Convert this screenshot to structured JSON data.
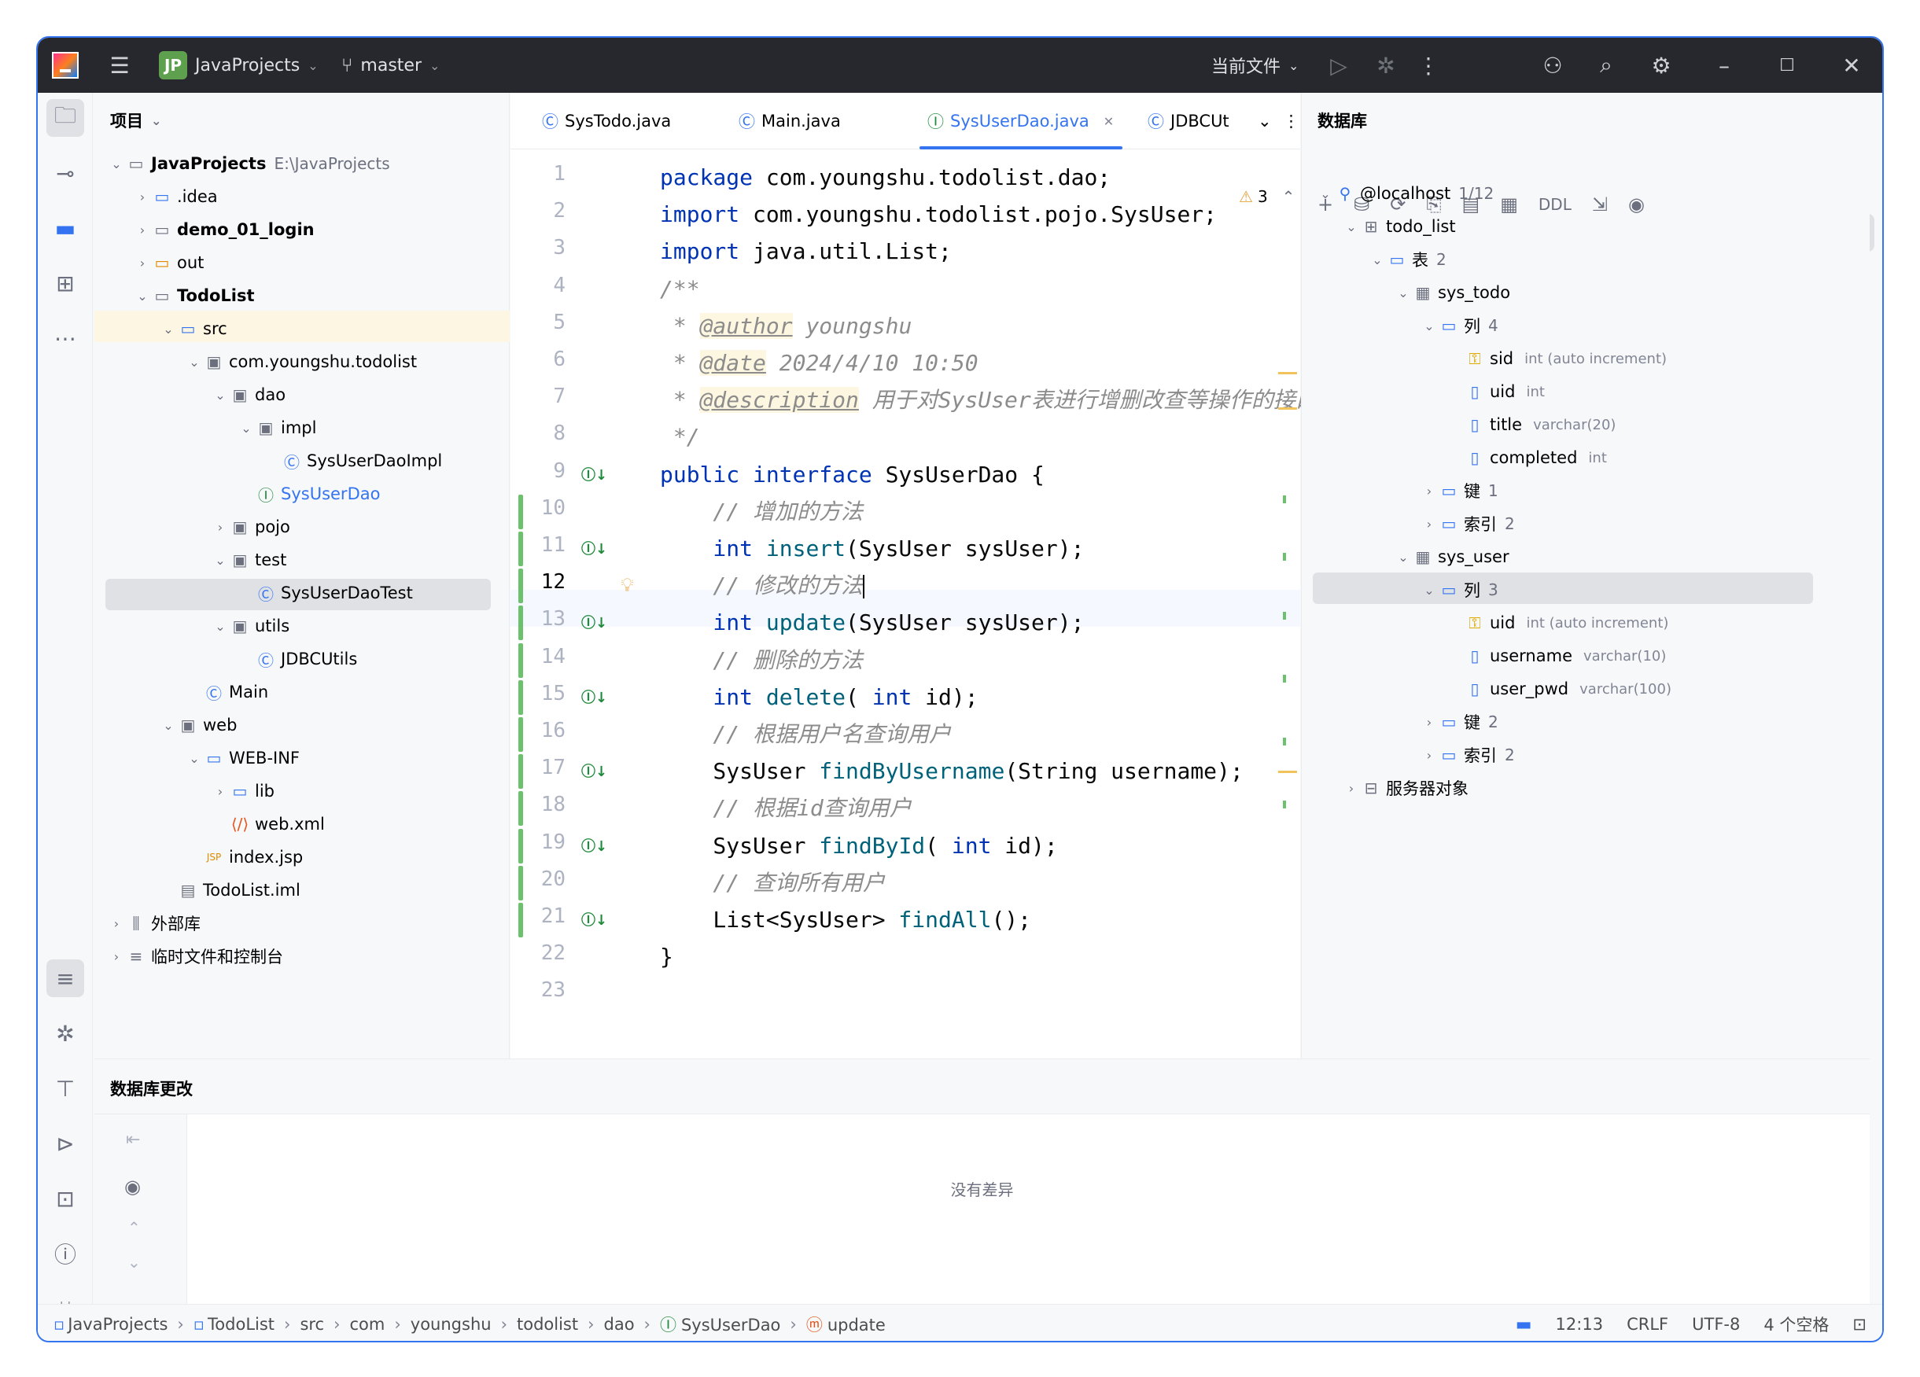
{
  "titlebar": {
    "project_badge": "JP",
    "project_name": "JavaProjects",
    "branch": "master",
    "run_config": "当前文件"
  },
  "project_panel": {
    "title": "项目",
    "tree": [
      {
        "label": "JavaProjects",
        "hint": "E:\\JavaProjects",
        "depth": 0,
        "icon": "module-folder-icon",
        "bold": true,
        "expanded": true
      },
      {
        "label": ".idea",
        "depth": 1,
        "icon": "folder-icon",
        "expanded": false
      },
      {
        "label": "demo_01_login",
        "depth": 1,
        "icon": "module-folder-icon",
        "bold": true,
        "expanded": false
      },
      {
        "label": "out",
        "depth": 1,
        "icon": "folder-orange-icon",
        "expanded": false
      },
      {
        "label": "TodoList",
        "depth": 1,
        "icon": "module-folder-icon",
        "bold": true,
        "expanded": true
      },
      {
        "label": "src",
        "depth": 2,
        "icon": "source-folder-icon",
        "expanded": true
      },
      {
        "label": "com.youngshu.todolist",
        "depth": 3,
        "icon": "package-icon",
        "expanded": true
      },
      {
        "label": "dao",
        "depth": 4,
        "icon": "package-icon",
        "expanded": true
      },
      {
        "label": "impl",
        "depth": 5,
        "icon": "package-icon",
        "expanded": true
      },
      {
        "label": "SysUserDaoImpl",
        "depth": 6,
        "icon": "class-icon"
      },
      {
        "label": "SysUserDao",
        "depth": 5,
        "icon": "interface-icon",
        "selected": true
      },
      {
        "label": "pojo",
        "depth": 4,
        "icon": "package-icon",
        "expanded": false
      },
      {
        "label": "test",
        "depth": 4,
        "icon": "package-icon",
        "expanded": true
      },
      {
        "label": "SysUserDaoTest",
        "depth": 5,
        "icon": "runnable-class-icon"
      },
      {
        "label": "utils",
        "depth": 4,
        "icon": "package-icon",
        "expanded": true
      },
      {
        "label": "JDBCUtils",
        "depth": 5,
        "icon": "class-icon"
      },
      {
        "label": "Main",
        "depth": 3,
        "icon": "runnable-class-icon"
      },
      {
        "label": "web",
        "depth": 2,
        "icon": "web-folder-icon",
        "expanded": true
      },
      {
        "label": "WEB-INF",
        "depth": 3,
        "icon": "folder-icon",
        "expanded": true
      },
      {
        "label": "lib",
        "depth": 4,
        "icon": "folder-icon",
        "expanded": false
      },
      {
        "label": "web.xml",
        "depth": 4,
        "icon": "xml-file-icon"
      },
      {
        "label": "index.jsp",
        "depth": 3,
        "icon": "jsp-file-icon"
      },
      {
        "label": "TodoList.iml",
        "depth": 2,
        "icon": "iml-file-icon"
      },
      {
        "label": "外部库",
        "depth": 0,
        "icon": "library-icon",
        "expanded": false
      },
      {
        "label": "临时文件和控制台",
        "depth": 0,
        "icon": "scratch-icon",
        "expanded": false
      }
    ]
  },
  "editor": {
    "tabs": [
      {
        "label": "SysTodo.java",
        "icon": "class-icon"
      },
      {
        "label": "Main.java",
        "icon": "runnable-class-icon"
      },
      {
        "label": "SysUserDao.java",
        "icon": "interface-icon",
        "active": true
      },
      {
        "label": "JDBCUt",
        "icon": "class-icon"
      }
    ],
    "warning_count": "3",
    "current_line": 12,
    "lines": [
      {
        "n": "1",
        "tokens": [
          [
            "kw",
            "package"
          ],
          [
            "",
            "com.youngshu.todolist.dao;"
          ]
        ]
      },
      {
        "n": "2",
        "tokens": [
          [
            "kw",
            "import"
          ],
          [
            "",
            "com.youngshu.todolist.pojo.SysUser;"
          ]
        ]
      },
      {
        "n": "3",
        "tokens": [
          [
            "kw",
            "import"
          ],
          [
            "",
            "java.util.List;"
          ]
        ]
      },
      {
        "n": "4",
        "tokens": [
          [
            "cm",
            "/**"
          ]
        ]
      },
      {
        "n": "5",
        "tokens": [
          [
            "cm",
            " * "
          ],
          [
            "tag",
            "@author"
          ],
          [
            "cm",
            " youngshu"
          ]
        ]
      },
      {
        "n": "6",
        "tokens": [
          [
            "cm",
            " * "
          ],
          [
            "tag",
            "@date"
          ],
          [
            "cm",
            " 2024/4/10 10:50"
          ]
        ]
      },
      {
        "n": "7",
        "tokens": [
          [
            "cm",
            " * "
          ],
          [
            "tag",
            "@description"
          ],
          [
            "cm",
            " 用于对SysUser表进行增删改查等操作的接口"
          ]
        ]
      },
      {
        "n": "8",
        "tokens": [
          [
            "cm",
            " */"
          ]
        ]
      },
      {
        "n": "9",
        "tokens": [
          [
            "kw",
            "public interface"
          ],
          [
            "",
            "SysUserDao {"
          ]
        ],
        "impl": true
      },
      {
        "n": "10",
        "tokens": [
          [
            "cm",
            "    // 增加的方法"
          ]
        ],
        "changed": true
      },
      {
        "n": "11",
        "tokens": [
          [
            "kw",
            "    int"
          ],
          [
            "fn",
            "insert"
          ],
          [
            "",
            "(SysUser sysUser);"
          ]
        ],
        "changed": true,
        "impl": true
      },
      {
        "n": "12",
        "tokens": [
          [
            "cm",
            "    // 修改的方法"
          ]
        ],
        "changed": true,
        "caret": true
      },
      {
        "n": "13",
        "tokens": [
          [
            "kw",
            "    int"
          ],
          [
            "fn",
            "update"
          ],
          [
            "",
            "(SysUser sysUser);"
          ]
        ],
        "changed": true,
        "impl": true
      },
      {
        "n": "14",
        "tokens": [
          [
            "cm",
            "    // 删除的方法"
          ]
        ],
        "changed": true
      },
      {
        "n": "15",
        "tokens": [
          [
            "kw",
            "    int"
          ],
          [
            "fn",
            "delete"
          ],
          [
            "",
            "("
          ],
          [
            "kw",
            "int"
          ],
          [
            "",
            "id);"
          ]
        ],
        "changed": true,
        "impl": true
      },
      {
        "n": "16",
        "tokens": [
          [
            "cm",
            "    // 根据用户名查询用户"
          ]
        ],
        "changed": true
      },
      {
        "n": "17",
        "tokens": [
          [
            "",
            "    SysUser"
          ],
          [
            "fn",
            "findByUsername"
          ],
          [
            "",
            "(String username);"
          ]
        ],
        "changed": true,
        "impl": true
      },
      {
        "n": "18",
        "tokens": [
          [
            "cm",
            "    // 根据id查询用户"
          ]
        ],
        "changed": true
      },
      {
        "n": "19",
        "tokens": [
          [
            "",
            "    SysUser"
          ],
          [
            "fn",
            "findById"
          ],
          [
            "",
            "("
          ],
          [
            "kw",
            "int"
          ],
          [
            "",
            "id);"
          ]
        ],
        "changed": true,
        "impl": true
      },
      {
        "n": "20",
        "tokens": [
          [
            "cm",
            "    // 查询所有用户"
          ]
        ],
        "changed": true
      },
      {
        "n": "21",
        "tokens": [
          [
            "",
            "    List<SysUser>"
          ],
          [
            "fn",
            "findAll"
          ],
          [
            "",
            "();"
          ]
        ],
        "changed": true,
        "impl": true
      },
      {
        "n": "22",
        "tokens": [
          [
            "",
            "}"
          ]
        ]
      },
      {
        "n": "23",
        "tokens": []
      }
    ]
  },
  "database_panel": {
    "title": "数据库",
    "toolbar_ddl": "DDL",
    "tree": [
      {
        "label": "@localhost",
        "hint": "1/12",
        "depth": 0,
        "icon": "datasource-icon",
        "expanded": true
      },
      {
        "label": "todo_list",
        "depth": 1,
        "icon": "schema-icon",
        "expanded": true
      },
      {
        "label": "表",
        "hint": "2",
        "depth": 2,
        "icon": "folder-icon",
        "expanded": true
      },
      {
        "label": "sys_todo",
        "depth": 3,
        "icon": "table-icon",
        "expanded": true
      },
      {
        "label": "列",
        "hint": "4",
        "depth": 4,
        "icon": "folder-icon",
        "expanded": true
      },
      {
        "label": "sid",
        "type": "int (auto increment)",
        "depth": 5,
        "icon": "primary-key-column-icon"
      },
      {
        "label": "uid",
        "type": "int",
        "depth": 5,
        "icon": "column-icon"
      },
      {
        "label": "title",
        "type": "varchar(20)",
        "depth": 5,
        "icon": "column-icon"
      },
      {
        "label": "completed",
        "type": "int",
        "depth": 5,
        "icon": "column-icon"
      },
      {
        "label": "键",
        "hint": "1",
        "depth": 4,
        "icon": "folder-icon",
        "expanded": false
      },
      {
        "label": "索引",
        "hint": "2",
        "depth": 4,
        "icon": "folder-icon",
        "expanded": false,
        "selected": true
      },
      {
        "label": "sys_user",
        "depth": 3,
        "icon": "table-icon",
        "expanded": true
      },
      {
        "label": "列",
        "hint": "3",
        "depth": 4,
        "icon": "folder-icon",
        "expanded": true
      },
      {
        "label": "uid",
        "type": "int (auto increment)",
        "depth": 5,
        "icon": "primary-key-column-icon"
      },
      {
        "label": "username",
        "type": "varchar(10)",
        "depth": 5,
        "icon": "column-icon"
      },
      {
        "label": "user_pwd",
        "type": "varchar(100)",
        "depth": 5,
        "icon": "column-icon"
      },
      {
        "label": "键",
        "hint": "2",
        "depth": 4,
        "icon": "folder-icon",
        "expanded": false
      },
      {
        "label": "索引",
        "hint": "2",
        "depth": 4,
        "icon": "folder-icon",
        "expanded": false
      },
      {
        "label": "服务器对象",
        "depth": 1,
        "icon": "server-objects-icon",
        "expanded": false
      }
    ]
  },
  "bottom_panel": {
    "title": "数据库更改",
    "empty_text": "没有差异"
  },
  "statusbar": {
    "breadcrumbs": [
      "JavaProjects",
      "TodoList",
      "src",
      "com",
      "youngshu",
      "todolist",
      "dao",
      "SysUserDao",
      "update"
    ],
    "position": "12:13",
    "line_sep": "CRLF",
    "encoding": "UTF-8",
    "indent": "4 个空格"
  }
}
